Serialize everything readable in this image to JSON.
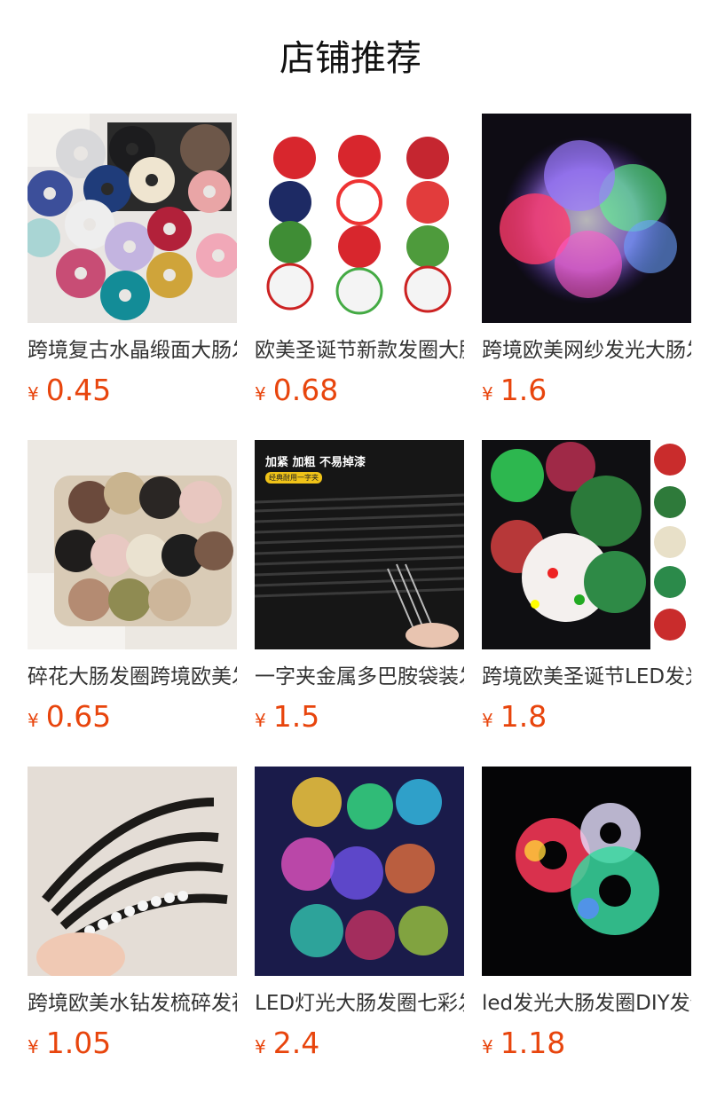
{
  "section": {
    "title": "店铺推荐"
  },
  "currency_symbol": "¥",
  "products": [
    {
      "name": "跨境复古水晶缎面大肠发圈",
      "price": "0.45",
      "image": "satin-scrunchies-photo"
    },
    {
      "name": "欧美圣诞节新款发圈大肠发圈",
      "price": "0.68",
      "image": "christmas-print-scrunchies-photo"
    },
    {
      "name": "跨境欧美网纱发光大肠发圈",
      "price": "1.6",
      "image": "glowing-mesh-scrunchie-photo"
    },
    {
      "name": "碎花大肠发圈跨境欧美发饰",
      "price": "0.65",
      "image": "floral-scrunchies-photo"
    },
    {
      "name": "一字夹金属多巴胺袋装发夹",
      "price": "1.5",
      "image": "black-bobby-pins-photo"
    },
    {
      "name": "跨境欧美圣诞节LED发光发圈",
      "price": "1.8",
      "image": "christmas-led-scrunchies-photo"
    },
    {
      "name": "跨境欧美水钻发梳碎发神器",
      "price": "1.05",
      "image": "rhinestone-hair-combs-photo"
    },
    {
      "name": "LED灯光大肠发圈七彩发光",
      "price": "2.4",
      "image": "led-light-scrunchies-photo"
    },
    {
      "name": "led发光大肠发圈DIY发饰",
      "price": "1.18",
      "image": "led-glow-scrunchies-photo"
    }
  ],
  "image_texts": {
    "pins_banner": "加紧 加粗 不易掉漆",
    "pins_badge": "经典耐用一字夹"
  },
  "colors": {
    "price": "#e8450d",
    "title": "#111111",
    "name": "#333333"
  }
}
